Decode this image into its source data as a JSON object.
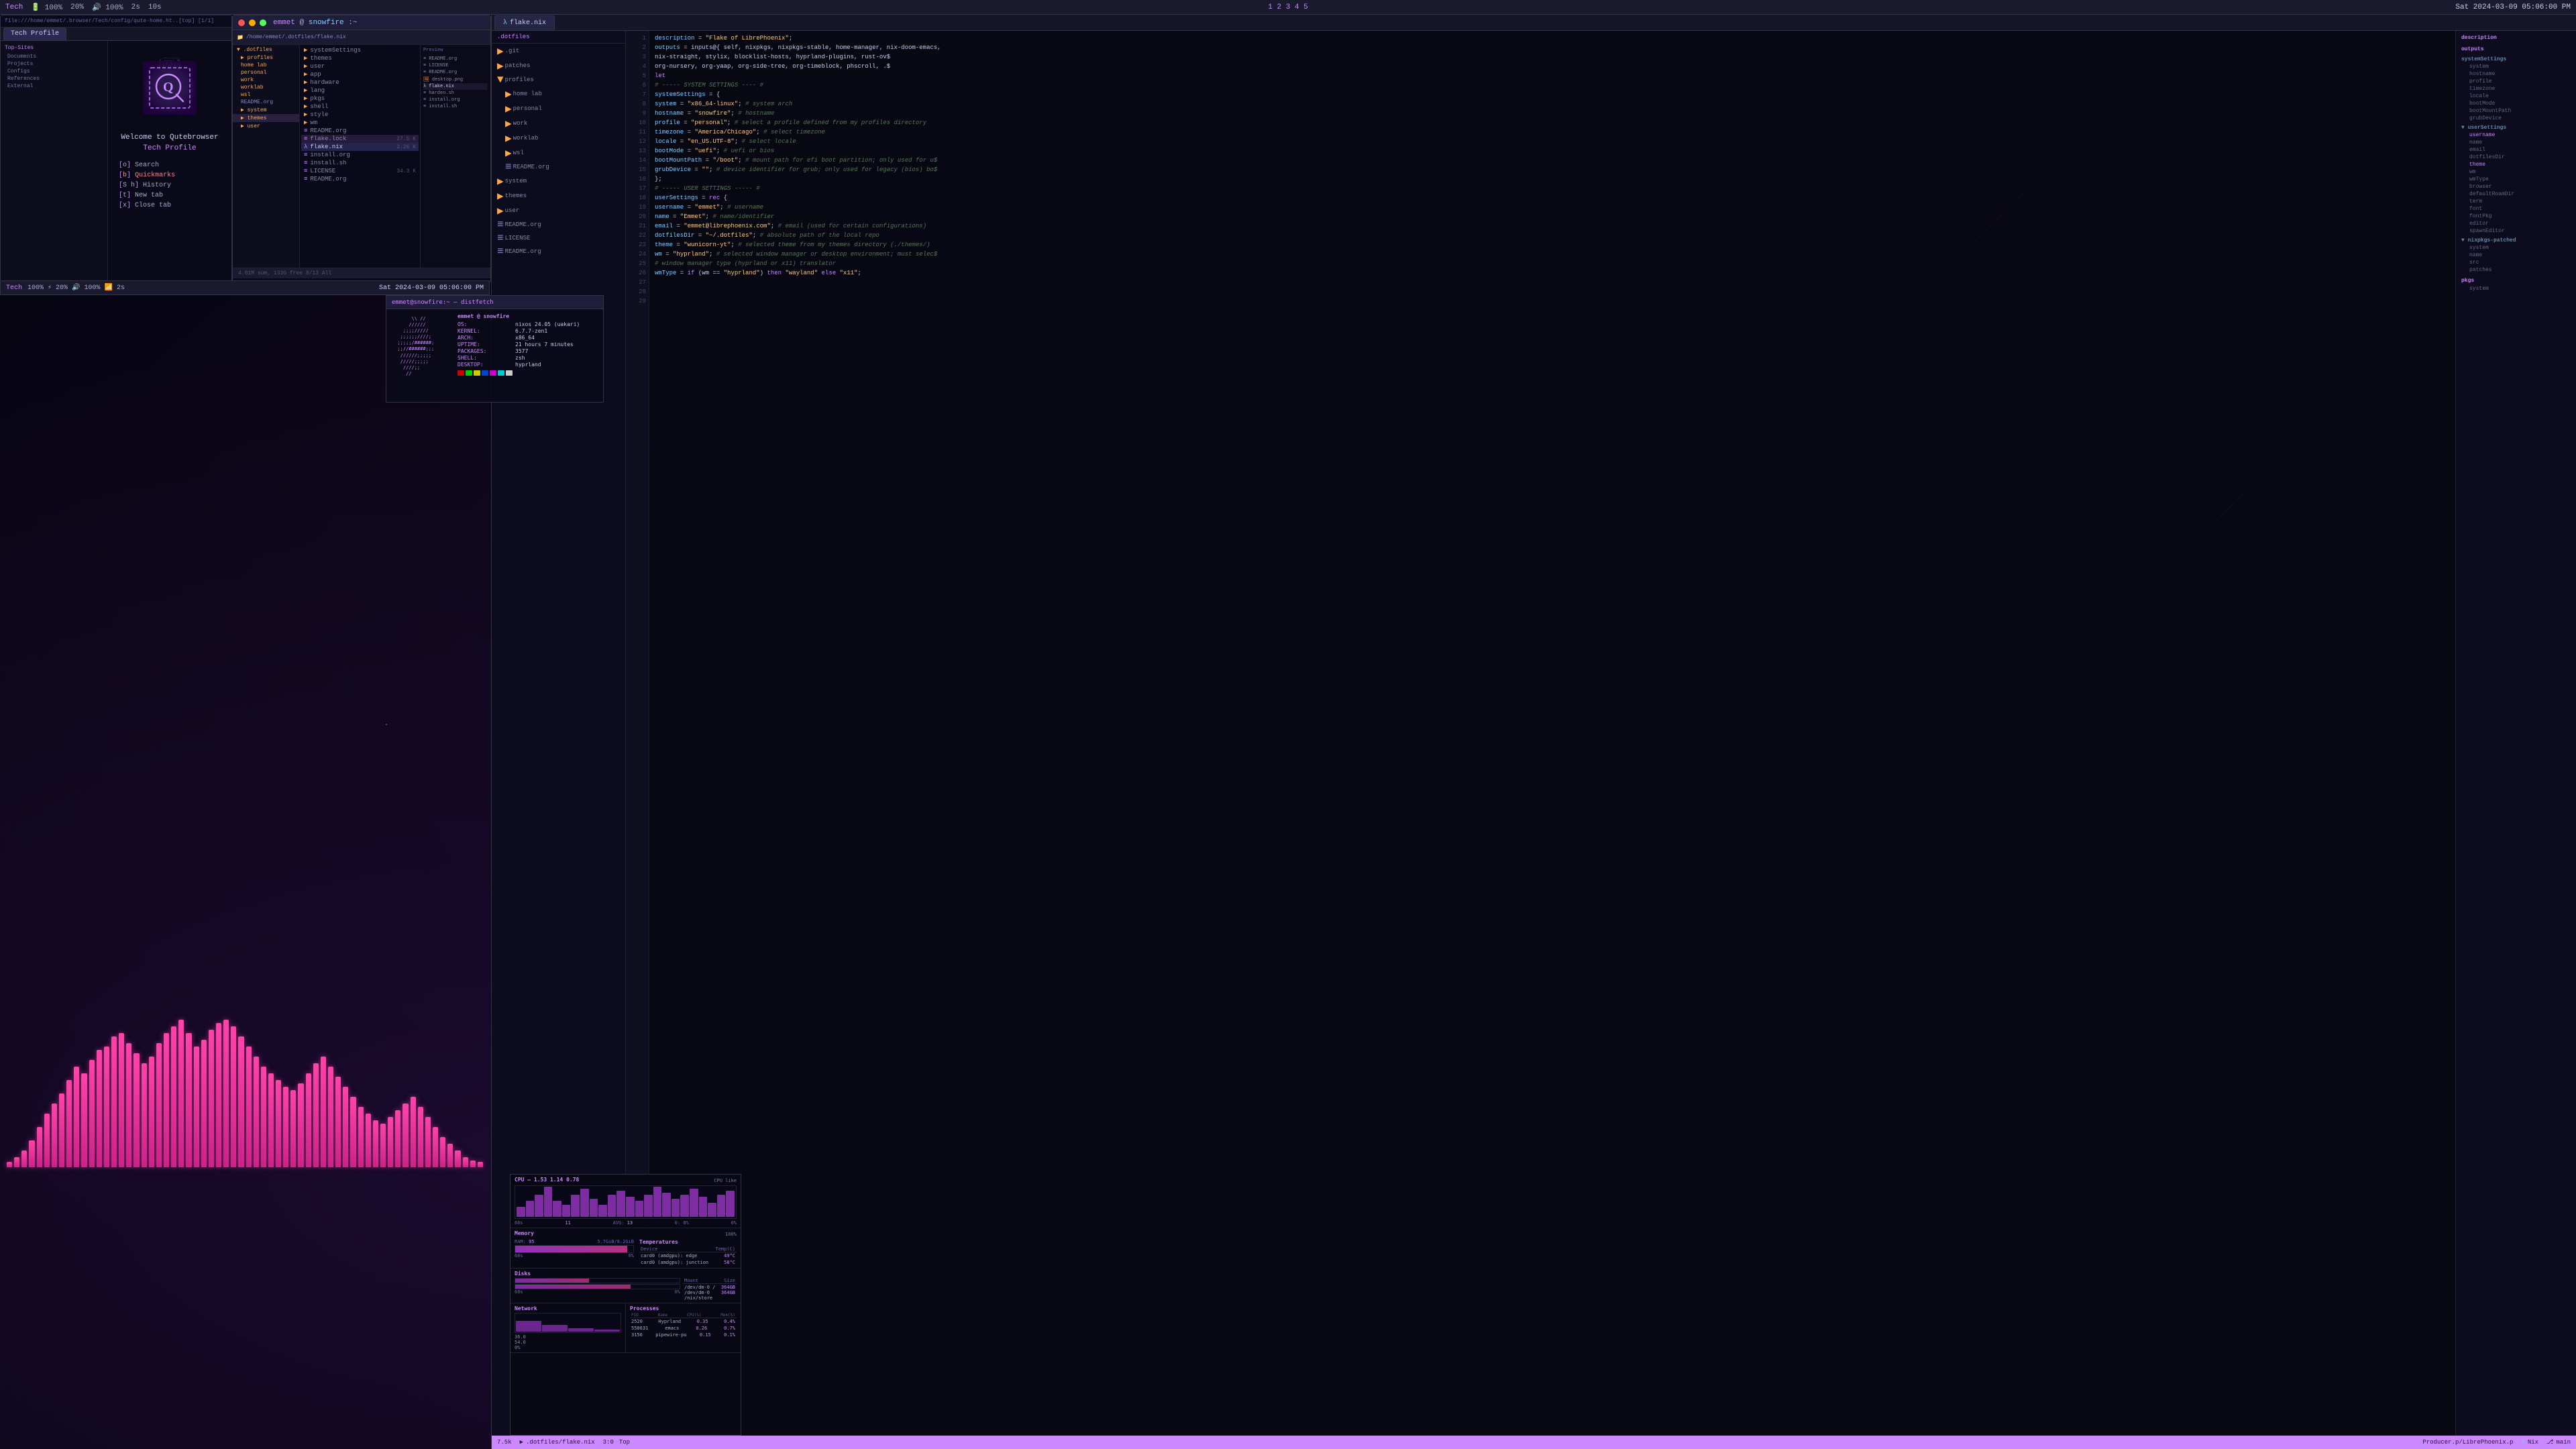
{
  "meta": {
    "date": "Sat 2024-03-09 05:06:00 PM",
    "os": "NixOS",
    "hostname": "snowfire",
    "user": "emmet"
  },
  "topbar": {
    "left": {
      "wm": "Tech",
      "battery": "100%",
      "brightness": "20%",
      "volume": "100%",
      "network": "2s",
      "mem": "10s"
    },
    "time": "Sat 2024-03-09 05:06:00 PM"
  },
  "qutebrowser": {
    "title": "Qutebrowser",
    "url": "file:///home/emmet/.browser/Tech/config/qute-home.ht..[top] [1/1]",
    "tab_label": "Tech Profile",
    "welcome": "Welcome to Qutebrowser",
    "profile": "Tech Profile",
    "menu": [
      {
        "key": "o",
        "label": "Search"
      },
      {
        "key": "b",
        "label": "Quickmarks",
        "active": true
      },
      {
        "key": "S h",
        "label": "History"
      },
      {
        "key": "t",
        "label": "New tab"
      },
      {
        "key": "x",
        "label": "Close tab"
      }
    ],
    "sidebar": {
      "sections": [
        {
          "name": "Top-Sites",
          "items": [
            "Documents",
            "Projects",
            "Configs",
            "References",
            "External"
          ]
        }
      ]
    }
  },
  "filemanager": {
    "title": "emmet@snowfire:~",
    "address": "/home/emmet/.dotfiles/flake.nix",
    "sidebar": [
      {
        "label": "home lab",
        "type": "folder",
        "indent": 0
      },
      {
        "label": "personal",
        "type": "folder",
        "indent": 0
      },
      {
        "label": "work",
        "type": "folder",
        "indent": 0
      },
      {
        "label": "worklab",
        "type": "folder",
        "indent": 0
      },
      {
        "label": "wsl",
        "type": "folder",
        "indent": 0
      },
      {
        "label": "README.org",
        "type": "file",
        "indent": 0
      }
    ],
    "files": [
      {
        "name": "systemSettings",
        "type": "folder",
        "size": ""
      },
      {
        "name": "themes",
        "type": "folder",
        "size": ""
      },
      {
        "name": "user",
        "type": "folder",
        "size": ""
      },
      {
        "name": "app",
        "type": "folder",
        "size": ""
      },
      {
        "name": "hardware",
        "type": "folder",
        "size": ""
      },
      {
        "name": "lang",
        "type": "folder",
        "size": ""
      },
      {
        "name": "pkgs",
        "type": "folder",
        "size": ""
      },
      {
        "name": "shell",
        "type": "folder",
        "size": ""
      },
      {
        "name": "style",
        "type": "folder",
        "size": ""
      },
      {
        "name": "wm",
        "type": "folder",
        "size": ""
      },
      {
        "name": "README.org",
        "type": "file",
        "size": ""
      },
      {
        "name": "flake.lock",
        "type": "file",
        "size": "27.5 K"
      },
      {
        "name": "flake.nix",
        "type": "file",
        "size": "2.26 K",
        "selected": true
      },
      {
        "name": "install.org",
        "type": "file",
        "size": ""
      },
      {
        "name": "install.sh",
        "type": "file",
        "size": ""
      },
      {
        "name": "LICENSE",
        "type": "file",
        "size": "34.3 K"
      },
      {
        "name": "README.org",
        "type": "file",
        "size": ""
      }
    ],
    "preview_files": [
      {
        "name": "README.org",
        "type": "file"
      },
      {
        "name": "LICENSE",
        "type": "file"
      },
      {
        "name": "README.org",
        "type": "file"
      },
      {
        "name": "desktop.png",
        "type": "file"
      },
      {
        "name": "flake.nix",
        "type": "file"
      },
      {
        "name": "harden.sh",
        "type": "file"
      },
      {
        "name": "install.org",
        "type": "file"
      },
      {
        "name": "install.sh",
        "type": "file"
      }
    ],
    "statusbar": "4.01M sum, 133G free  8/13  All"
  },
  "editor": {
    "title": "flake.nix",
    "tabs": [
      {
        "label": "flake.nix",
        "active": true
      }
    ],
    "filetree": {
      "root": ".dotfiles",
      "items": [
        {
          "label": ".git",
          "type": "folder",
          "indent": 1
        },
        {
          "label": "patches",
          "type": "folder",
          "indent": 1
        },
        {
          "label": "profiles",
          "type": "folder",
          "indent": 1
        },
        {
          "label": "home lab",
          "type": "folder",
          "indent": 2
        },
        {
          "label": "personal",
          "type": "folder",
          "indent": 2
        },
        {
          "label": "work",
          "type": "folder",
          "indent": 2
        },
        {
          "label": "worklab",
          "type": "folder",
          "indent": 2
        },
        {
          "label": "wsl",
          "type": "folder",
          "indent": 2
        },
        {
          "label": "README.org",
          "type": "file",
          "indent": 2
        },
        {
          "label": "system",
          "type": "folder",
          "indent": 1
        },
        {
          "label": "themes",
          "type": "folder",
          "indent": 1
        },
        {
          "label": "user",
          "type": "folder",
          "indent": 1
        },
        {
          "label": "README.org",
          "type": "file",
          "indent": 1
        },
        {
          "label": "LICENSE",
          "type": "file",
          "indent": 1
        },
        {
          "label": "README.org",
          "type": "file",
          "indent": 1
        }
      ]
    },
    "code_lines": [
      {
        "n": 1,
        "text": "  description = \"Flake of LibrePhoenix\";"
      },
      {
        "n": 2,
        "text": ""
      },
      {
        "n": 3,
        "text": "  outputs = inputs@{ self, nixpkgs, nixpkgs-stable, home-manager, nix-doom-emacs,"
      },
      {
        "n": 4,
        "text": "    nix-straight, stylix, blocklist-hosts, hyprland-plugins, rust-ov$"
      },
      {
        "n": 5,
        "text": "    org-nursery, org-yaap, org-side-tree, org-timeblock, phscroll, .$"
      },
      {
        "n": 6,
        "text": "  let"
      },
      {
        "n": 7,
        "text": ""
      },
      {
        "n": 8,
        "text": "    # ----- SYSTEM SETTINGS ---- #"
      },
      {
        "n": 9,
        "text": "    systemSettings = {"
      },
      {
        "n": 10,
        "text": "      system = \"x86_64-linux\"; # system arch"
      },
      {
        "n": 11,
        "text": "      hostname = \"snowfire\"; # hostname"
      },
      {
        "n": 12,
        "text": "      profile = \"personal\"; # select a profile defined from my profiles directory"
      },
      {
        "n": 13,
        "text": "      timezone = \"America/Chicago\"; # select timezone"
      },
      {
        "n": 14,
        "text": "      locale = \"en_US.UTF-8\"; # select locale"
      },
      {
        "n": 15,
        "text": "      bootMode = \"uefi\"; # uefi or bios"
      },
      {
        "n": 16,
        "text": "      bootMountPath = \"/boot\"; # mount path for efi boot partition; only used for u$"
      },
      {
        "n": 17,
        "text": "      grubDevice = \"\"; # device identifier for grub; only used for legacy (bios) bo$"
      },
      {
        "n": 18,
        "text": "    };"
      },
      {
        "n": 19,
        "text": ""
      },
      {
        "n": 20,
        "text": "    # ----- USER SETTINGS ----- #"
      },
      {
        "n": 21,
        "text": "    userSettings = rec {"
      },
      {
        "n": 22,
        "text": "      username = \"emmet\"; # username"
      },
      {
        "n": 23,
        "text": "      name = \"Emmet\"; # name/identifier"
      },
      {
        "n": 24,
        "text": "      email = \"emmet@librephoenix.com\"; # email (used for certain configurations)"
      },
      {
        "n": 25,
        "text": "      dotfilesDir = \"~/.dotfiles\"; # absolute path of the local repo"
      },
      {
        "n": 26,
        "text": "      theme = \"wunicorn-yt\"; # selected theme from my themes directory (./themes/)"
      },
      {
        "n": 27,
        "text": "      wm = \"hyprland\"; # selected window manager or desktop environment; must selec$"
      },
      {
        "n": 28,
        "text": "      # window manager type (hyprland or x11) translator"
      },
      {
        "n": 29,
        "text": "      wmType = if (wm == \"hyprland\") then \"wayland\" else \"x11\";"
      }
    ],
    "outline": {
      "sections": [
        {
          "name": "description",
          "items": []
        },
        {
          "name": "outputs",
          "items": []
        },
        {
          "name": "systemSettings",
          "items": [
            "system",
            "hostname",
            "profile",
            "timezone",
            "locale",
            "bootMode",
            "bootMountPath",
            "grubDevice"
          ]
        },
        {
          "name": "▼ userSettings",
          "items": [
            "username",
            "name",
            "email",
            "dotfilesDir",
            "theme",
            "wm",
            "wmType",
            "browser",
            "defaultRoamDir",
            "term",
            "font",
            "fontPkg",
            "editor",
            "spawnEditor"
          ]
        },
        {
          "name": "▼ nixpkgs-patched",
          "items": [
            "system",
            "name",
            "src",
            "patches"
          ]
        },
        {
          "name": "pkgs",
          "items": [
            "system"
          ]
        }
      ]
    },
    "statusbar": {
      "lines": "7.5k",
      "file": ".dotfiles/flake.nix",
      "pos": "3:0",
      "top": "Top",
      "producer": "Producer.p/LibrePhoenix.p",
      "lang": "Nix",
      "branch": "main"
    }
  },
  "neofetch": {
    "user_host": "emmet @ snowfire",
    "os": "nixos 24.05 (uakari)",
    "kernel": "6.7.7-zen1",
    "arch": "x86_64",
    "uptime": "21 hours 7 minutes",
    "packages": "3577",
    "shell": "zsh",
    "desktop": "hyprland",
    "logo_lines": [
      "       \\\\  //      ",
      "      //////      ",
      "     ;;;;/////    ",
      "    ;;;;;;/////   ",
      "   ;;;;;/######;  ",
      "  ;;//######;;;   ",
      " //////;;;;;      ",
      " /////;;;;;;      ",
      "  ////;;          ",
      "   //             "
    ]
  },
  "sysmonitor": {
    "cpu": {
      "title": "CPU - 1.53 1.14 0.78",
      "usage": 11,
      "avg": 13,
      "min": 0,
      "max": 0
    },
    "memory": {
      "title": "Memory",
      "ram_pct": 95,
      "ram_used": "5.7GiB/8.2GiB"
    },
    "temperatures": {
      "title": "Temperatures",
      "items": [
        {
          "device": "card0 (amdgpu): edge",
          "temp": "49°C"
        },
        {
          "device": "card0 (amdgpu): junction",
          "temp": "58°C"
        }
      ]
    },
    "disks": {
      "title": "Disks",
      "items": [
        {
          "mount": "/dev/dm-0",
          "size": "364GB"
        },
        {
          "mount": "/dev/dm-0 /nix/store",
          "size": "364GB"
        }
      ]
    },
    "network": {
      "title": "Network",
      "up": "36.0",
      "down": "54.0",
      "idle": "0%"
    },
    "processes": {
      "title": "Processes",
      "items": [
        {
          "pid": "2520",
          "name": "Hyprland",
          "cpu": "0.3%",
          "mem": "0.4%"
        },
        {
          "pid": "550631",
          "name": "emacs",
          "cpu": "0.2%",
          "mem": "0.7%"
        },
        {
          "pid": "3156",
          "name": "pipewire-pu",
          "cpu": "0.1%",
          "mem": "0.1%"
        }
      ]
    }
  },
  "viz_bars": [
    8,
    15,
    25,
    40,
    60,
    80,
    95,
    110,
    130,
    150,
    140,
    160,
    175,
    180,
    195,
    200,
    185,
    170,
    155,
    165,
    185,
    200,
    210,
    220,
    200,
    180,
    190,
    205,
    215,
    220,
    210,
    195,
    180,
    165,
    150,
    140,
    130,
    120,
    115,
    125,
    140,
    155,
    165,
    150,
    135,
    120,
    105,
    90,
    80,
    70,
    65,
    75,
    85,
    95,
    105,
    90,
    75,
    60,
    45,
    35,
    25,
    15,
    10,
    8
  ]
}
